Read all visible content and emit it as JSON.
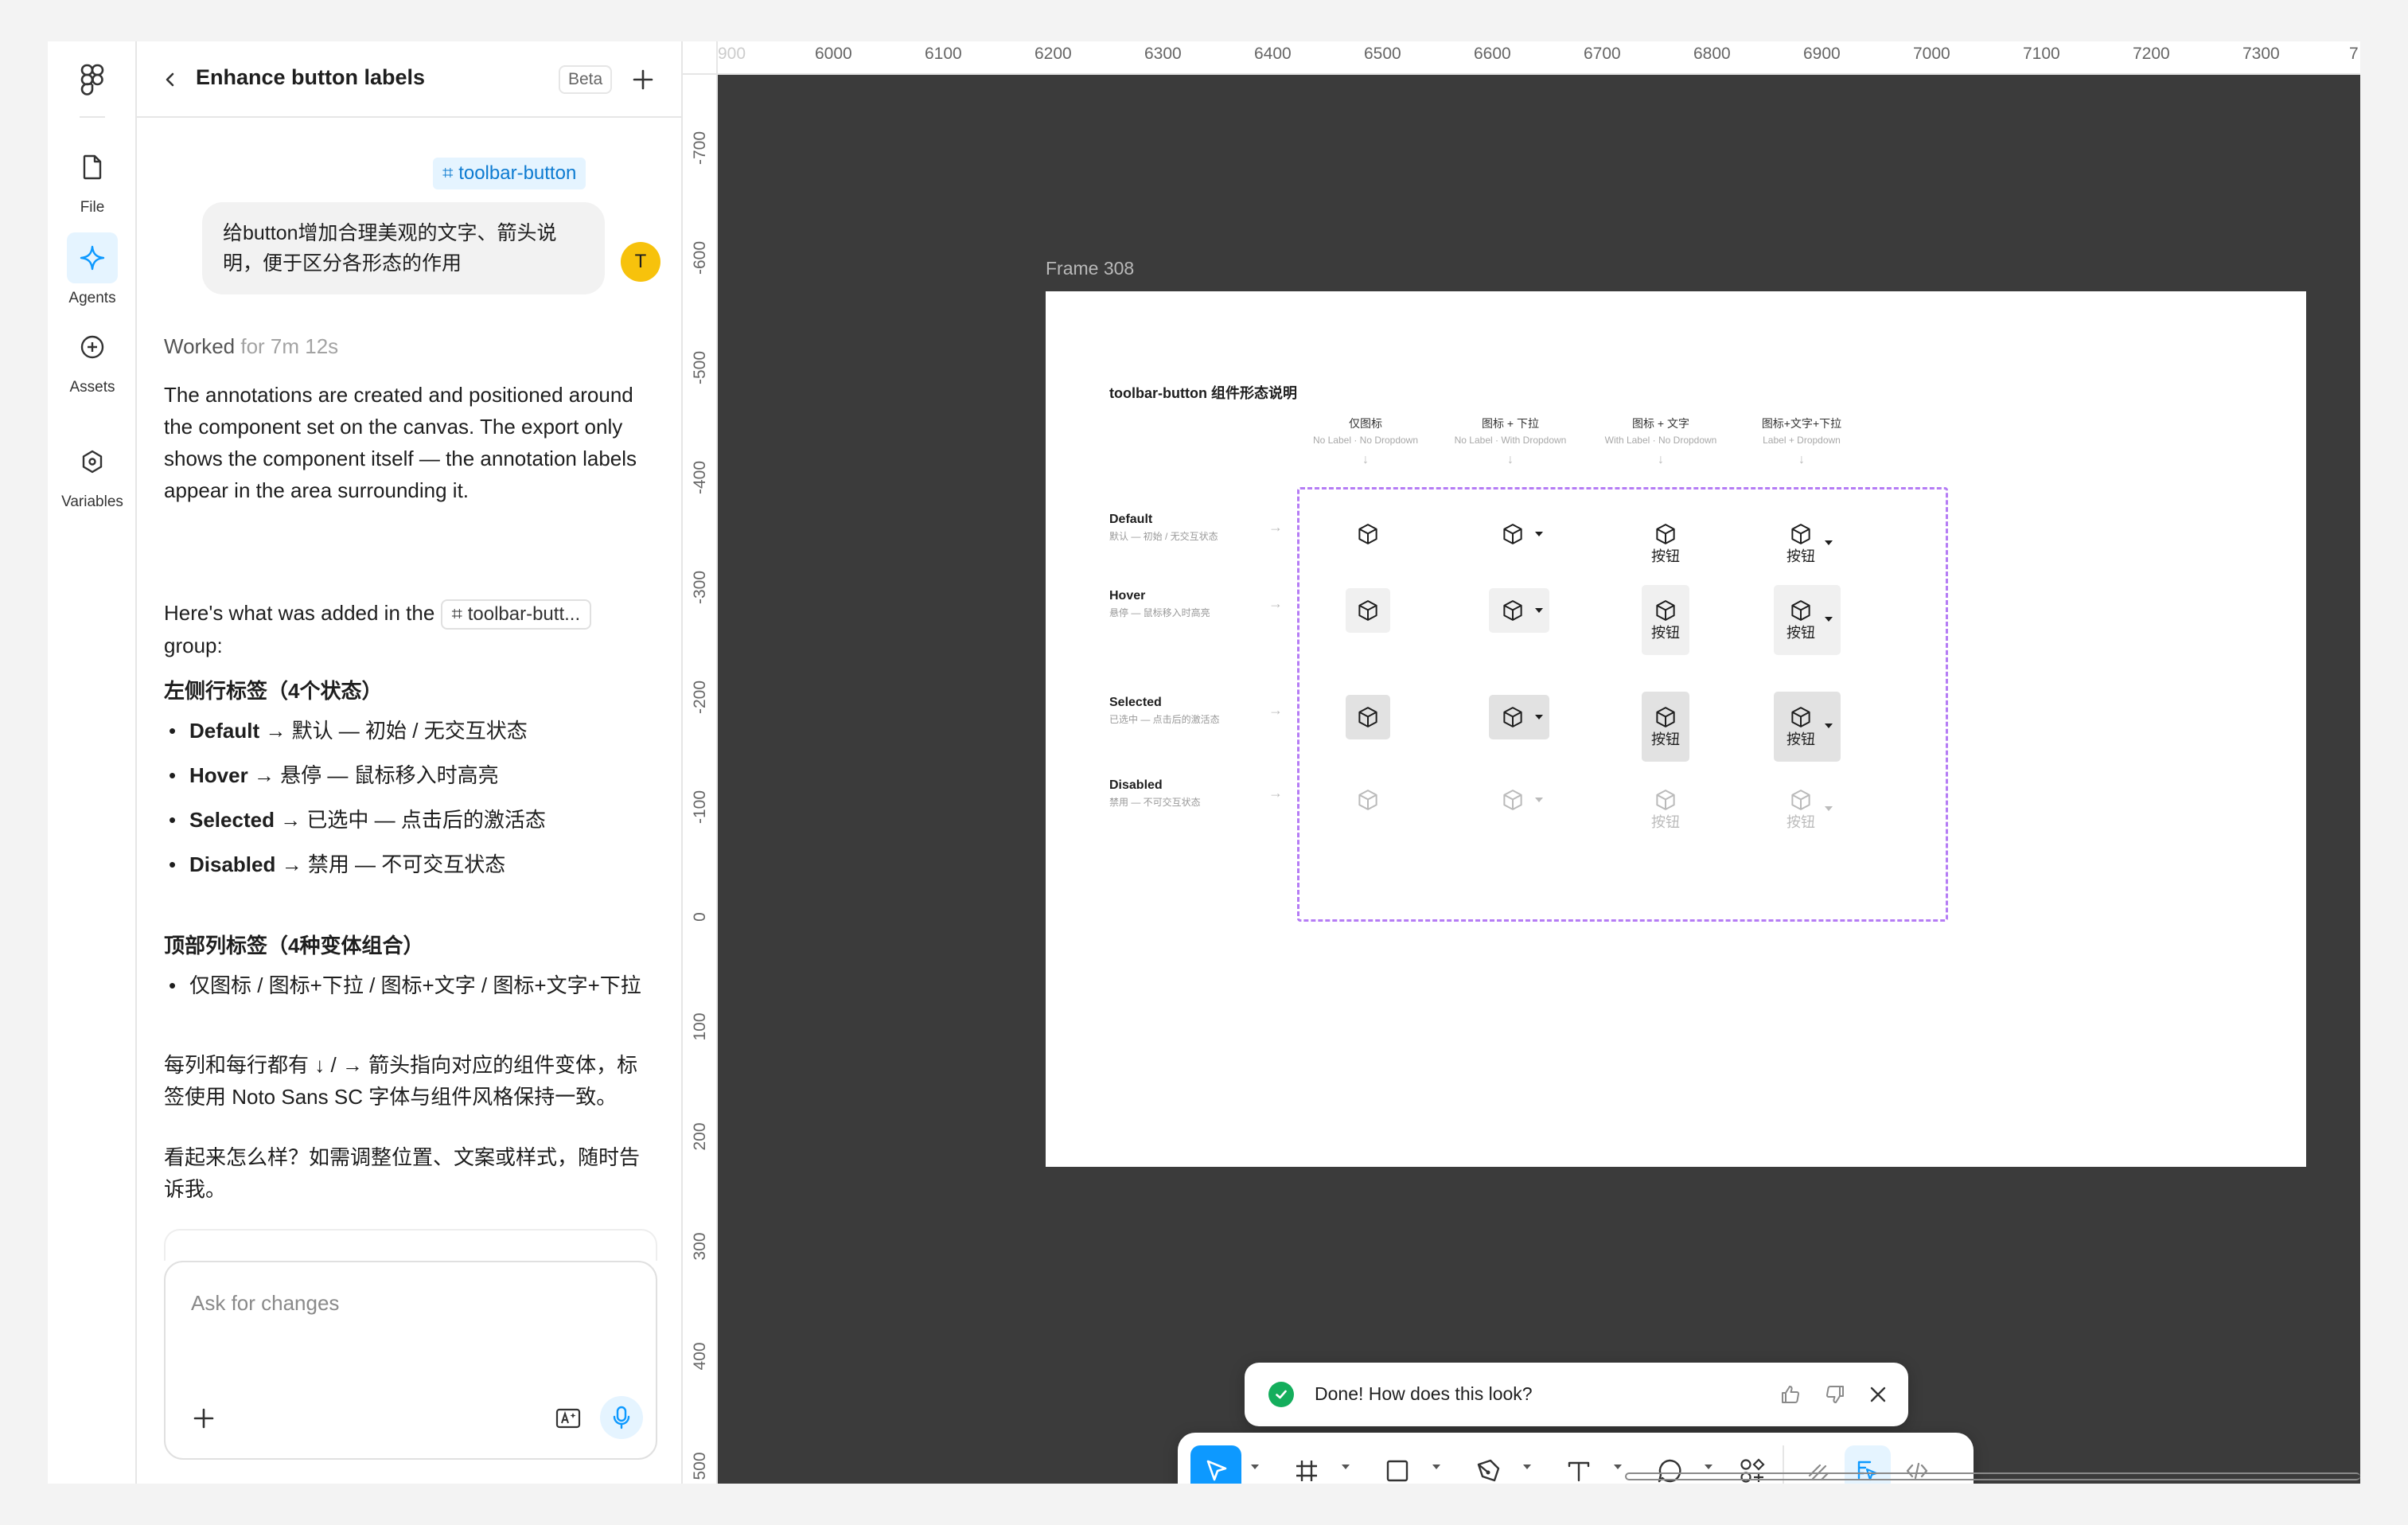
{
  "rail": {
    "items": [
      {
        "label": "File",
        "icon": "file-icon"
      },
      {
        "label": "Agents",
        "icon": "sparkle-icon",
        "active": true
      },
      {
        "label": "Assets",
        "icon": "plus-circle-icon"
      },
      {
        "label": "Variables",
        "icon": "hexagon-icon"
      }
    ]
  },
  "panel": {
    "title": "Enhance button labels",
    "beta": "Beta",
    "chip": "toolbar-button",
    "user_message": "给button增加合理美观的文字、箭头说明，便于区分各形态的作用",
    "avatar_initial": "T",
    "worked_prefix": "Worked",
    "worked_duration": "for 7m 12s",
    "para1": "The annotations are created and positioned around the component set on the canvas. The export only shows the component itself — the annotation labels appear in the area surrounding it.",
    "para2_before": "Here's what was added in the",
    "para2_chip": "toolbar-butt...",
    "para2_after": "group:",
    "h_left": "左侧行标签（4个状态）",
    "left_bullets": [
      {
        "bold": "Default",
        "rest": " → 默认 — 初始 / 无交互状态"
      },
      {
        "bold": "Hover",
        "rest": " → 悬停 — 鼠标移入时高亮"
      },
      {
        "bold": "Selected",
        "rest": " → 已选中 — 点击后的激活态"
      },
      {
        "bold": "Disabled",
        "rest": " → 禁用 — 不可交互状态"
      }
    ],
    "h_top": "顶部列标签（4种变体组合）",
    "top_bullet": "仅图标 / 图标+下拉 / 图标+文字 / 图标+文字+下拉",
    "para3": "每列和每行都有 ↓ / → 箭头指向对应的组件变体，标签使用 Noto Sans SC 字体与组件风格保持一致。",
    "para4": "看起来怎么样？如需调整位置、文案或样式，随时告诉我。",
    "composer_placeholder": "Ask for changes"
  },
  "ruler": {
    "top": [
      "6000",
      "6100",
      "6200",
      "6300",
      "6400",
      "6500",
      "6600",
      "6700",
      "6800",
      "6900",
      "7000",
      "7100",
      "7200",
      "7300",
      "7"
    ],
    "top_first_faint": "900",
    "left": [
      "-700",
      "-600",
      "-500",
      "-400",
      "-300",
      "-200",
      "-100",
      "0",
      "100",
      "200",
      "300",
      "400",
      "500"
    ]
  },
  "canvas": {
    "frame_label": "Frame 308",
    "frame": {
      "title": "toolbar-button 组件形态说明",
      "columns": [
        {
          "zh": "仅图标",
          "en": "No Label · No Dropdown"
        },
        {
          "zh": "图标 + 下拉",
          "en": "No Label · With Dropdown"
        },
        {
          "zh": "图标 + 文字",
          "en": "With Label · No Dropdown"
        },
        {
          "zh": "图标+文字+下拉",
          "en": "Label + Dropdown"
        }
      ],
      "rows": [
        {
          "en": "Default",
          "zh": "默认 — 初始 / 无交互状态"
        },
        {
          "en": "Hover",
          "zh": "悬停 — 鼠标移入时高亮"
        },
        {
          "en": "Selected",
          "zh": "已选中 — 点击后的激活态"
        },
        {
          "en": "Disabled",
          "zh": "禁用 — 不可交互状态"
        }
      ],
      "button_label": "按钮",
      "arrow_down": "↓",
      "arrow_right": "→"
    }
  },
  "toast": {
    "text": "Done! How does this look?",
    "success_color": "#14ae5c"
  },
  "toolbar": {
    "tools": [
      "move-icon",
      "frame-icon",
      "rectangle-icon",
      "pen-icon",
      "text-icon",
      "comment-icon",
      "actions-icon"
    ],
    "modes": [
      "draw-mode-icon",
      "design-mode-icon",
      "dev-mode-icon"
    ],
    "accent": "#0d99ff"
  }
}
